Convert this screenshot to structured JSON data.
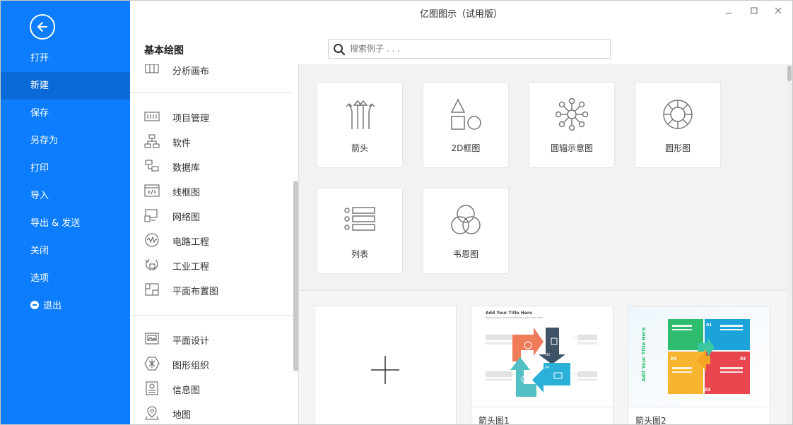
{
  "window": {
    "title": "亿图图示（试用版）"
  },
  "nav": {
    "items": [
      {
        "label": "打开"
      },
      {
        "label": "新建"
      },
      {
        "label": "保存"
      },
      {
        "label": "另存为"
      },
      {
        "label": "打印"
      },
      {
        "label": "导入"
      },
      {
        "label": "导出 & 发送"
      },
      {
        "label": "关闭"
      },
      {
        "label": "选项"
      },
      {
        "label": "退出"
      }
    ],
    "active": "新建"
  },
  "header": {
    "section_title": "基本绘图"
  },
  "search": {
    "placeholder": "搜索例子 . . ."
  },
  "categories": {
    "partial_top": "分析画布",
    "group1": [
      "项目管理",
      "软件",
      "数据库",
      "线框图",
      "网络图",
      "电路工程",
      "工业工程",
      "平面布置图"
    ],
    "group2": [
      "平面设计",
      "图形组织",
      "信息图",
      "地图"
    ]
  },
  "tiles": [
    {
      "label": "箭头",
      "icon": "arrows-icon"
    },
    {
      "label": "2D框图",
      "icon": "shapes-2d-icon"
    },
    {
      "label": "圆辐示意图",
      "icon": "radial-icon"
    },
    {
      "label": "圆形图",
      "icon": "circular-icon"
    },
    {
      "label": "列表",
      "icon": "list-icon"
    },
    {
      "label": "韦恩图",
      "icon": "venn-icon"
    }
  ],
  "templates": [
    {
      "label": "箭头图1",
      "heading": "Add Your Title Here",
      "subheading": "Replace your text here   Replace your text here"
    },
    {
      "label": "箭头图2",
      "heading": "Add Your Title Here"
    }
  ],
  "colors": {
    "accent": "#0d7dff",
    "nav_active": "#0a6ad8"
  }
}
